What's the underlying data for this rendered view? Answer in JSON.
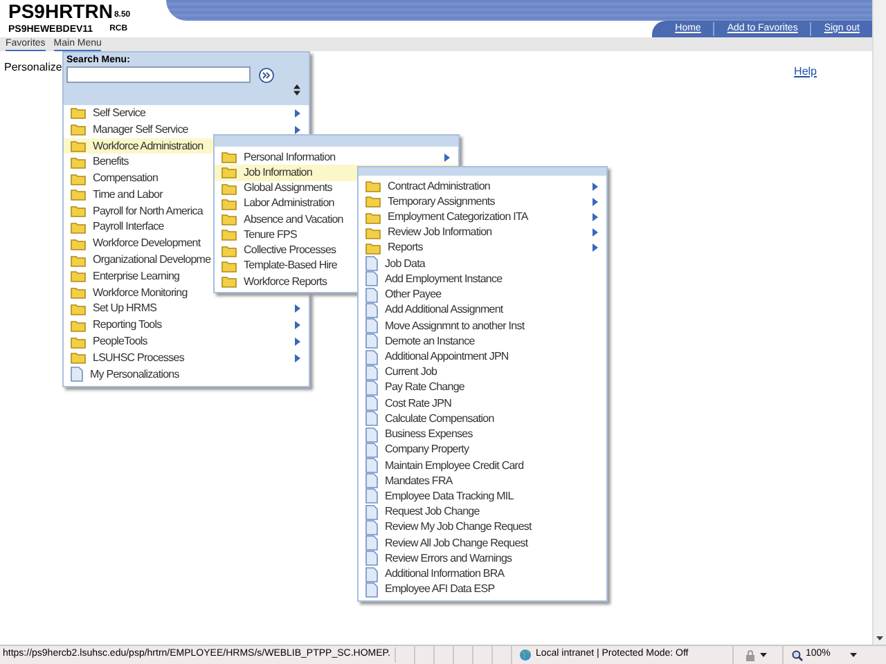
{
  "header": {
    "title": "PS9HRTRN",
    "version": "8.50",
    "server": "PS9HEWEBDEV11",
    "user": "RCB",
    "links": [
      "Home",
      "Add to Favorites",
      "Sign out"
    ]
  },
  "menubar": [
    "Favorites",
    "Main Menu"
  ],
  "page": {
    "personalize": "Personalize",
    "help": "Help"
  },
  "search_menu": {
    "label": "Search Menu:"
  },
  "main_menu": [
    {
      "label": "Self Service",
      "kind": "folder",
      "submenu": true,
      "selected": false
    },
    {
      "label": "Manager Self Service",
      "kind": "folder",
      "submenu": true,
      "selected": false
    },
    {
      "label": "Workforce Administration",
      "kind": "folder",
      "submenu": false,
      "selected": true
    },
    {
      "label": "Benefits",
      "kind": "folder",
      "submenu": false,
      "selected": false
    },
    {
      "label": "Compensation",
      "kind": "folder",
      "submenu": false,
      "selected": false
    },
    {
      "label": "Time and Labor",
      "kind": "folder",
      "submenu": false,
      "selected": false
    },
    {
      "label": "Payroll for North America",
      "kind": "folder",
      "submenu": false,
      "selected": false
    },
    {
      "label": "Payroll Interface",
      "kind": "folder",
      "submenu": false,
      "selected": false
    },
    {
      "label": "Workforce Development",
      "kind": "folder",
      "submenu": false,
      "selected": false
    },
    {
      "label": "Organizational Developme",
      "kind": "folder",
      "submenu": false,
      "selected": false
    },
    {
      "label": "Enterprise Learning",
      "kind": "folder",
      "submenu": false,
      "selected": false
    },
    {
      "label": "Workforce Monitoring",
      "kind": "folder",
      "submenu": false,
      "selected": false
    },
    {
      "label": "Set Up HRMS",
      "kind": "folder",
      "submenu": true,
      "selected": false
    },
    {
      "label": "Reporting Tools",
      "kind": "folder",
      "submenu": true,
      "selected": false
    },
    {
      "label": "PeopleTools",
      "kind": "folder",
      "submenu": true,
      "selected": false
    },
    {
      "label": "LSUHSC Processes",
      "kind": "folder",
      "submenu": true,
      "selected": false
    },
    {
      "label": "My Personalizations",
      "kind": "page",
      "submenu": false,
      "selected": false
    }
  ],
  "workforce_menu": [
    {
      "label": "Personal Information",
      "kind": "folder",
      "submenu": true,
      "selected": false
    },
    {
      "label": "Job Information",
      "kind": "folder",
      "submenu": false,
      "selected": true
    },
    {
      "label": "Global Assignments",
      "kind": "folder",
      "submenu": false,
      "selected": false
    },
    {
      "label": "Labor Administration",
      "kind": "folder",
      "submenu": false,
      "selected": false
    },
    {
      "label": "Absence and Vacation",
      "kind": "folder",
      "submenu": false,
      "selected": false
    },
    {
      "label": "Tenure FPS",
      "kind": "folder",
      "submenu": false,
      "selected": false
    },
    {
      "label": "Collective Processes",
      "kind": "folder",
      "submenu": false,
      "selected": false
    },
    {
      "label": "Template-Based Hire",
      "kind": "folder",
      "submenu": false,
      "selected": false
    },
    {
      "label": "Workforce Reports",
      "kind": "folder",
      "submenu": false,
      "selected": false
    }
  ],
  "job_menu": [
    {
      "label": "Contract Administration",
      "kind": "folder",
      "submenu": true,
      "selected": false
    },
    {
      "label": "Temporary Assignments",
      "kind": "folder",
      "submenu": true,
      "selected": false
    },
    {
      "label": "Employment Categorization ITA",
      "kind": "folder",
      "submenu": true,
      "selected": false
    },
    {
      "label": "Review Job Information",
      "kind": "folder",
      "submenu": true,
      "selected": false
    },
    {
      "label": "Reports",
      "kind": "folder",
      "submenu": true,
      "selected": false
    },
    {
      "label": "Job Data",
      "kind": "page",
      "submenu": false,
      "selected": false
    },
    {
      "label": "Add Employment Instance",
      "kind": "page",
      "submenu": false,
      "selected": false
    },
    {
      "label": "Other Payee",
      "kind": "page",
      "submenu": false,
      "selected": false
    },
    {
      "label": "Add Additional Assignment",
      "kind": "page",
      "submenu": false,
      "selected": false
    },
    {
      "label": "Move Assignmnt to another Inst",
      "kind": "page",
      "submenu": false,
      "selected": false
    },
    {
      "label": "Demote an Instance",
      "kind": "page",
      "submenu": false,
      "selected": false
    },
    {
      "label": "Additional Appointment JPN",
      "kind": "page",
      "submenu": false,
      "selected": false
    },
    {
      "label": "Current Job",
      "kind": "page",
      "submenu": false,
      "selected": false
    },
    {
      "label": "Pay Rate Change",
      "kind": "page",
      "submenu": false,
      "selected": false
    },
    {
      "label": "Cost Rate JPN",
      "kind": "page",
      "submenu": false,
      "selected": false
    },
    {
      "label": "Calculate Compensation",
      "kind": "page",
      "submenu": false,
      "selected": false
    },
    {
      "label": "Business Expenses",
      "kind": "page",
      "submenu": false,
      "selected": false
    },
    {
      "label": "Company Property",
      "kind": "page",
      "submenu": false,
      "selected": false
    },
    {
      "label": "Maintain Employee Credit Card",
      "kind": "page",
      "submenu": false,
      "selected": false
    },
    {
      "label": "Mandates FRA",
      "kind": "page",
      "submenu": false,
      "selected": false
    },
    {
      "label": "Employee Data Tracking MIL",
      "kind": "page",
      "submenu": false,
      "selected": false
    },
    {
      "label": "Request Job Change",
      "kind": "page",
      "submenu": false,
      "selected": false
    },
    {
      "label": "Review My Job Change Request",
      "kind": "page",
      "submenu": false,
      "selected": false
    },
    {
      "label": "Review All Job Change Request",
      "kind": "page",
      "submenu": false,
      "selected": false
    },
    {
      "label": "Review Errors and Warnings",
      "kind": "page",
      "submenu": false,
      "selected": false
    },
    {
      "label": "Additional Information BRA",
      "kind": "page",
      "submenu": false,
      "selected": false
    },
    {
      "label": "Employee AFI Data ESP",
      "kind": "page",
      "submenu": false,
      "selected": false
    }
  ],
  "status_bar": {
    "url": "https://ps9hercb2.lsuhsc.edu/psp/hrtrn/EMPLOYEE/HRMS/s/WEBLIB_PTPP_SC.HOMEP.",
    "zone": "Local intranet | Protected Mode: Off",
    "zoom": "100%"
  }
}
